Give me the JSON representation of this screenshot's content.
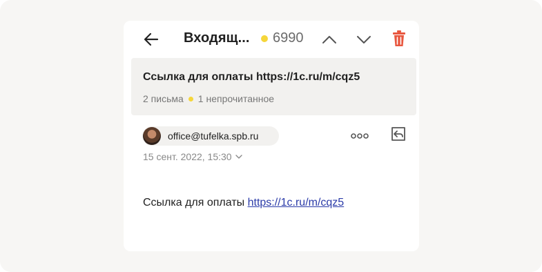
{
  "toolbar": {
    "folder_title": "Входящ...",
    "unread_count": "6990",
    "icons": [
      "arrow-left-icon",
      "chevron-up-icon",
      "chevron-down-icon",
      "trash-icon"
    ],
    "colors": {
      "unread_dot": "#f5d63a",
      "trash": "#e8573f"
    }
  },
  "thread": {
    "subject": "Ссылка для оплаты https://1c.ru/m/cqz5",
    "letters_count": "2 письма",
    "unread_label": "1 непрочитанное"
  },
  "message": {
    "sender": "office@tufelka.spb.ru",
    "date": "15 сент. 2022, 15:30",
    "body_prefix": "Ссылка для оплаты ",
    "body_link": "https://1c.ru/m/cqz5",
    "icons": [
      "more-dots-icon",
      "reply-icon",
      "chevron-down-icon"
    ],
    "colors": {
      "link": "#2a3aa8"
    }
  }
}
